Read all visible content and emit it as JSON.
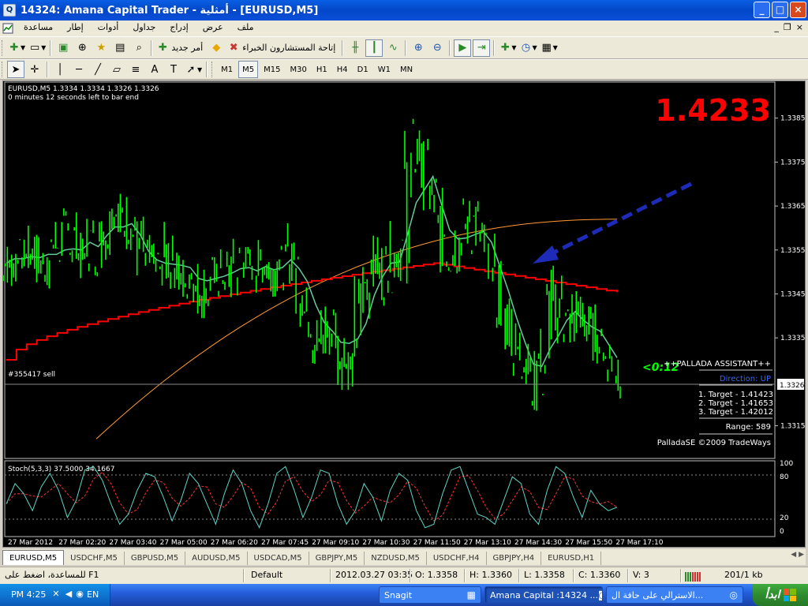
{
  "window": {
    "title": "14324: Amana Capital Trader - أمثلية - [EURUSD,M5]",
    "minimize": "_",
    "maximize": "□",
    "close": "×"
  },
  "menu": {
    "items": [
      "ملف",
      "عرض",
      "إدراج",
      "جداول",
      "أدوات",
      "إطار",
      "مساعدة"
    ],
    "mdi_minimize": "_",
    "mdi_restore": "❐",
    "mdi_close": "×"
  },
  "toolbar": {
    "new_order": "أمر جديد",
    "expert_advisors": "إتاحة المستشارون الخبراء",
    "timeframes": [
      "M1",
      "M5",
      "M15",
      "M30",
      "H1",
      "H4",
      "D1",
      "W1",
      "MN"
    ],
    "active_timeframe": "M5"
  },
  "chart": {
    "symbol_line": "EURUSD,M5  1.3334 1.3334 1.3326 1.3326",
    "bar_timer": "0 minutes 12 seconds left to bar end",
    "big_price": "1.4233",
    "order_label": "#355417 sell",
    "current_price": "1.3326",
    "timer_overlay": "<0:12",
    "assistant": {
      "title": "++PALLADA ASSISTANT++",
      "direction": "Direction: UP",
      "targets": [
        "1. Target - 1.41423",
        "2. Target - 1.41653",
        "3. Target - 1.42012"
      ],
      "range": "Range: 589",
      "copyright": "PalladaSE ©2009 TradeWays"
    },
    "stoch_label": "Stoch(5,3,3) 37.5000 34.1667",
    "colors": {
      "price": "#00ff00",
      "ma_slow": "#ff9933",
      "ma_red": "#ff0000",
      "ma_green": "#66cc99",
      "arrow": "#1e2bb8",
      "big_price": "#ff0000",
      "timer": "#00ff00"
    }
  },
  "chart_data": [
    {
      "type": "line",
      "title": "",
      "series": [
        {
          "name": "",
          "y": [
            1.3352,
            1.3354,
            1.3353,
            1.3355,
            1.3351,
            1.3357,
            1.3353,
            1.3359,
            1.3352,
            1.3356,
            1.336,
            1.3355,
            1.3362,
            1.3364,
            1.336,
            1.3358,
            1.3352,
            1.3349,
            1.3352,
            1.3355,
            1.3351,
            1.3348,
            1.335,
            1.3345,
            1.3349,
            1.335,
            1.3352,
            1.3348,
            1.3353,
            1.3351,
            1.3349,
            1.3352,
            1.335,
            1.3353,
            1.3356,
            1.3344,
            1.3338,
            1.3332,
            1.334,
            1.3336,
            1.3328,
            1.3331,
            1.3344,
            1.335,
            1.3354,
            1.3348,
            1.3356,
            1.3351,
            1.338,
            1.3376,
            1.3368,
            1.3363,
            1.3355,
            1.3352,
            1.336,
            1.3364,
            1.3358,
            1.3355,
            1.335,
            1.3342,
            1.3336,
            1.333,
            1.3328,
            1.3322,
            1.3334,
            1.3346,
            1.334,
            1.3336,
            1.3342,
            1.3338,
            1.3334,
            1.3332,
            1.333,
            1.3326
          ]
        }
      ],
      "y_ticks": [
        "1.3385",
        "1.3375",
        "1.3365",
        "1.3355",
        "1.3345",
        "1.3335",
        "1.3326",
        "1.3315"
      ],
      "ylim": [
        1.3309,
        1.3388
      ],
      "x_ticks": [
        "27 Mar 2012",
        "27 Mar 02:20",
        "27 Mar 03:40",
        "27 Mar 05:00",
        "27 Mar 06:20",
        "27 Mar 07:45",
        "27 Mar 09:10",
        "27 Mar 10:30",
        "27 Mar 11:50",
        "27 Mar 13:10",
        "27 Mar 14:30",
        "27 Mar 15:50",
        "27 Mar 17:10"
      ],
      "grid": false
    },
    {
      "type": "line",
      "title": "Stoch(5,3,3) 37.5000 34.1667",
      "series": [
        {
          "name": "",
          "y": [
            40,
            70,
            55,
            30,
            65,
            85,
            60,
            20,
            45,
            90,
            95,
            75,
            40,
            10,
            25,
            60,
            85,
            80,
            50,
            15,
            45,
            85,
            70,
            40,
            10,
            55,
            90,
            70,
            30,
            5,
            40,
            85,
            95,
            60,
            20,
            50,
            90,
            85,
            40,
            10,
            30,
            70,
            50,
            15,
            60,
            85,
            75,
            30,
            5,
            10,
            55,
            90,
            95,
            60,
            25,
            20,
            10,
            45,
            80,
            70,
            25,
            10,
            60,
            95,
            85,
            50,
            20,
            60,
            40,
            30,
            35
          ]
        }
      ],
      "y_ticks": [
        "100",
        "80",
        "20",
        "0"
      ],
      "ylim": [
        0,
        100
      ],
      "grid": false
    }
  ],
  "tabs": [
    "EURUSD,M5",
    "USDCHF,M5",
    "GBPUSD,M5",
    "AUDUSD,M5",
    "USDCAD,M5",
    "GBPJPY,M5",
    "NZDUSD,M5",
    "USDCHF,H4",
    "GBPJPY,H4",
    "EURUSD,H1"
  ],
  "active_tab": "EURUSD,M5",
  "status": {
    "help": "للمساعدة، اضغط على F1",
    "profile": "Default",
    "datetime": "2012.03.27 03:35",
    "open": "O: 1.3358",
    "high": "H: 1.3360",
    "low": "L: 1.3358",
    "close": "C: 1.3360",
    "volume": "V: 3",
    "traffic": "201/1 kb"
  },
  "taskbar": {
    "clock": "PM 4:25",
    "lang": "EN",
    "snagit": "Snagit",
    "amana": "Amana Capital :14324 ...",
    "browser": "الاسترالي على حافة ال...",
    "start": "ابدأ"
  }
}
